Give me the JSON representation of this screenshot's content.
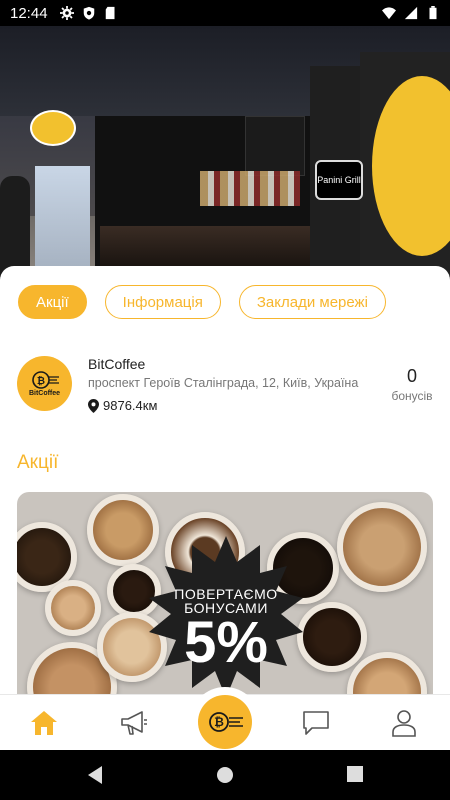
{
  "status_bar": {
    "time": "12:44",
    "left_icons": [
      "gear-icon",
      "shield-icon",
      "sd-card-icon"
    ],
    "right_icons": [
      "wifi-icon",
      "signal-icon",
      "battery-icon"
    ]
  },
  "hero": {
    "sign_text": "Panini Grill",
    "logo_text": "BitCoffee"
  },
  "tabs": [
    {
      "label": "Акції",
      "active": true
    },
    {
      "label": "Інформація",
      "active": false
    },
    {
      "label": "Заклади мережі",
      "active": false
    }
  ],
  "shop": {
    "logo_text": "BitCoffee",
    "name": "BitCoffee",
    "address": "проспект Героїв Сталінграда, 12, Київ, Україна",
    "distance": "9876.4км",
    "bonus_count": "0",
    "bonus_label": "бонусів"
  },
  "section": {
    "title": "Акції"
  },
  "promo": {
    "line1": "ПОВЕРТАЄМО",
    "line2": "БОНУСАМИ",
    "value": "5%"
  },
  "bottom_nav": {
    "items": [
      "home-icon",
      "megaphone-icon",
      "bitcoffee-logo-icon",
      "chat-icon",
      "profile-icon"
    ]
  },
  "colors": {
    "accent": "#f7b62d",
    "text": "#222222",
    "muted": "#777777"
  }
}
